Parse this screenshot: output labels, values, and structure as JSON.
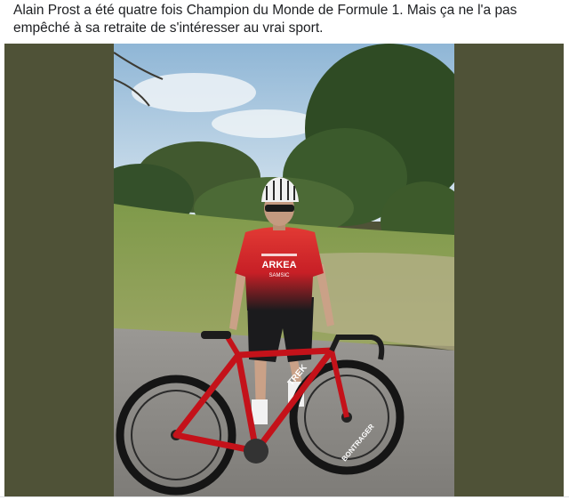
{
  "post": {
    "text": "Alain Prost a été quatre fois Champion du Monde de Formule 1. Mais ça ne l'a pas empêché à sa retraite de s'intéresser au vrai sport."
  },
  "photo": {
    "jersey_brand": "ARKEA",
    "jersey_sub": "SAMSIC",
    "wheel_brand": "BONTRAGER",
    "frame_brand": "TREK"
  },
  "colors": {
    "media_background": "#4f5237",
    "jersey_red": "#d8242c",
    "bike_red": "#c4121a"
  }
}
